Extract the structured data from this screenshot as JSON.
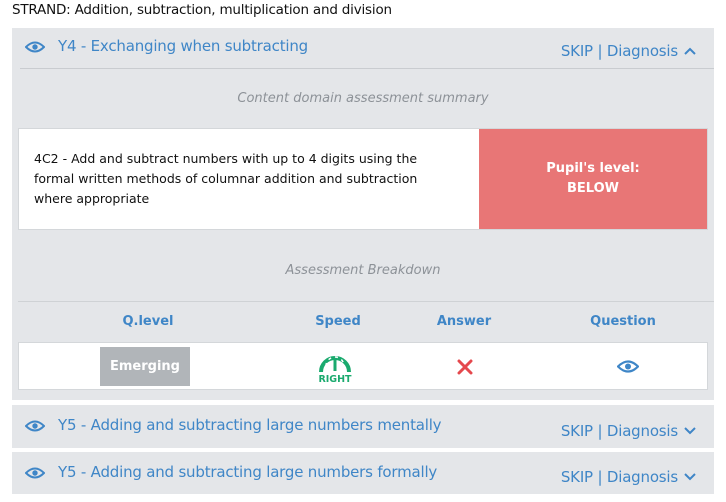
{
  "strand": "STRAND: Addition, subtraction, multiplication and division",
  "open_section": {
    "title": "Y4 - Exchanging when subtracting",
    "action": "SKIP | Diagnosis",
    "summary_heading": "Content domain assessment summary",
    "objective": "4C2 - Add and subtract numbers with up to 4 digits using the formal written methods of columnar addition and subtraction where appropriate",
    "pupil_level_label": "Pupil's level:",
    "pupil_level_value": "BELOW",
    "breakdown_heading": "Assessment Breakdown",
    "columns": [
      "Q.level",
      "Speed",
      "Answer",
      "Question"
    ],
    "row": {
      "q_level": "Emerging",
      "speed": "RIGHT",
      "answer": "incorrect",
      "question": "view-question"
    }
  },
  "collapsed_sections": [
    {
      "title": "Y5 - Adding and subtracting large numbers mentally",
      "action": "SKIP | Diagnosis"
    },
    {
      "title": "Y5 - Adding and subtracting large numbers formally",
      "action": "SKIP | Diagnosis"
    }
  ],
  "colors": {
    "accent": "#3f86c7",
    "panel": "#e4e6e9",
    "below": "#e87676",
    "speed": "#1aaa6e",
    "wrong": "#e5484d",
    "badge": "#b1b5b9"
  },
  "icons": [
    "eye-icon",
    "chevron-up-icon",
    "chevron-down-icon",
    "speedometer-icon",
    "cross-icon"
  ]
}
